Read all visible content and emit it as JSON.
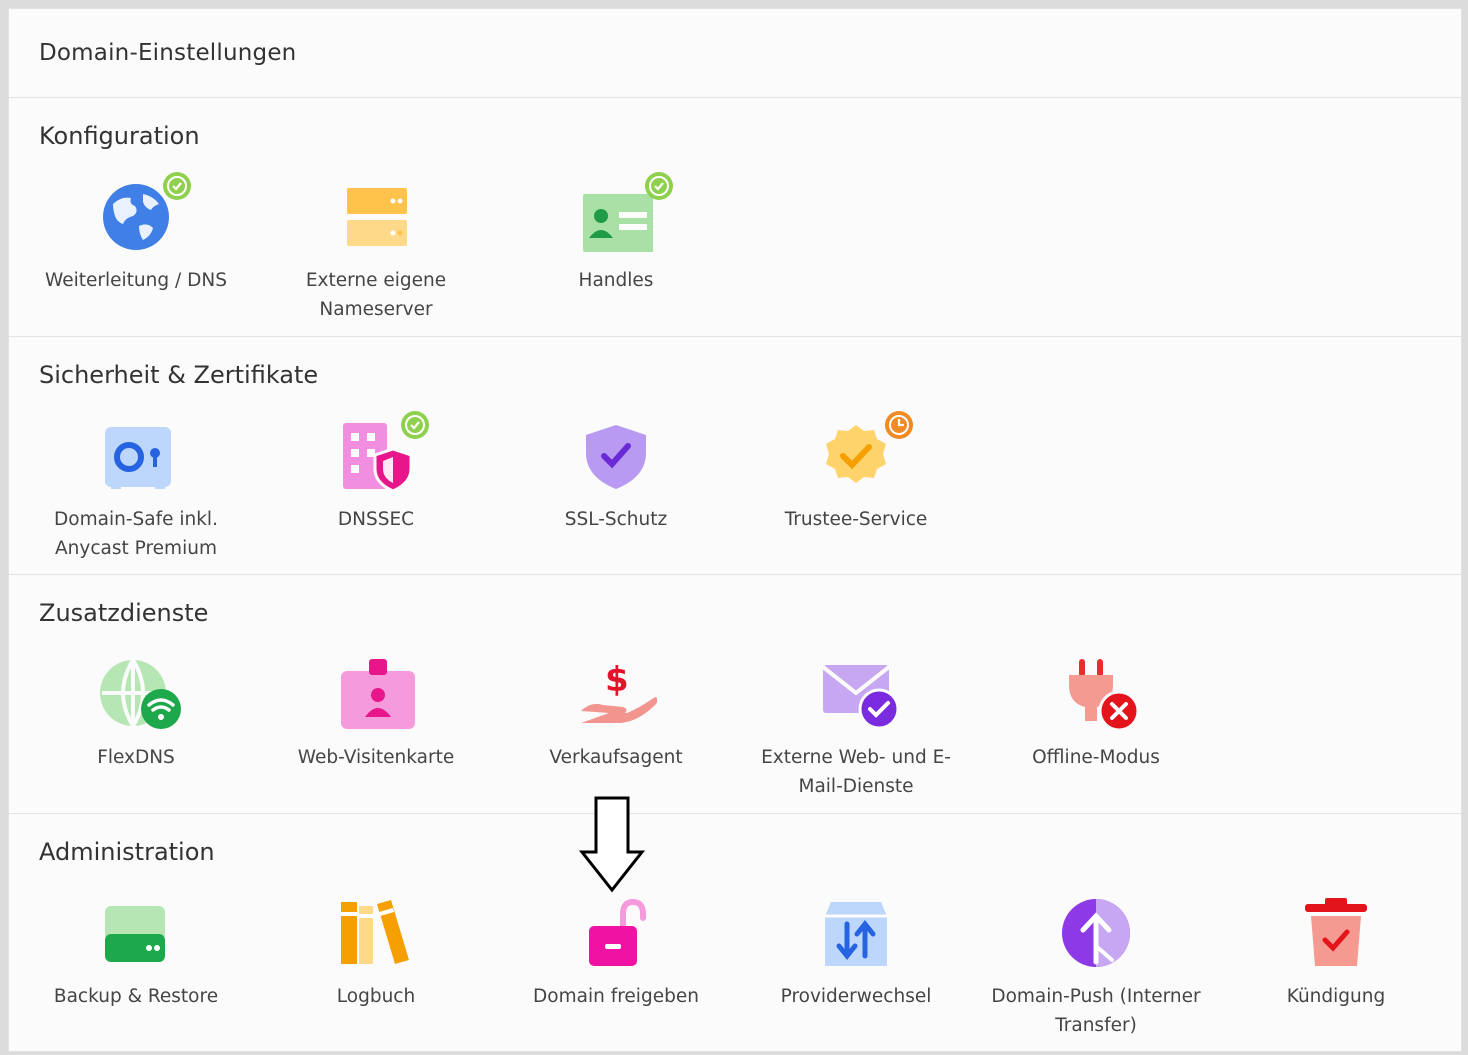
{
  "panel": {
    "title": "Domain-Einstellungen"
  },
  "sections": [
    {
      "title": "Konfiguration",
      "items": [
        {
          "label": "Weiterleitung / DNS",
          "icon": "globe-icon",
          "status": "check"
        },
        {
          "label": "Externe eigene Nameserver",
          "icon": "server-icon",
          "status": ""
        },
        {
          "label": "Handles",
          "icon": "contact-card-icon",
          "status": "check"
        }
      ]
    },
    {
      "title": "Sicherheit & Zertifikate",
      "items": [
        {
          "label": "Domain-Safe inkl. Anycast Premium",
          "icon": "safe-icon",
          "status": ""
        },
        {
          "label": "DNSSEC",
          "icon": "building-shield-icon",
          "status": "check"
        },
        {
          "label": "SSL-Schutz",
          "icon": "shield-check-icon",
          "status": ""
        },
        {
          "label": "Trustee-Service",
          "icon": "seal-check-icon",
          "status": "pending"
        }
      ]
    },
    {
      "title": "Zusatzdienste",
      "items": [
        {
          "label": "FlexDNS",
          "icon": "globe-wifi-icon",
          "status": ""
        },
        {
          "label": "Web-Visitenkarte",
          "icon": "badge-card-icon",
          "status": ""
        },
        {
          "label": "Verkaufsagent",
          "icon": "hand-dollar-icon",
          "status": ""
        },
        {
          "label": "Externe Web- und E-Mail-Dienste",
          "icon": "envelope-check-icon",
          "status": ""
        },
        {
          "label": "Offline-Modus",
          "icon": "plug-off-icon",
          "status": ""
        }
      ]
    },
    {
      "title": "Administration",
      "items": [
        {
          "label": "Backup & Restore",
          "icon": "drive-icon",
          "status": ""
        },
        {
          "label": "Logbuch",
          "icon": "books-icon",
          "status": ""
        },
        {
          "label": "Domain freigeben",
          "icon": "unlock-icon",
          "status": ""
        },
        {
          "label": "Providerwechsel",
          "icon": "box-transfer-icon",
          "status": ""
        },
        {
          "label": "Domain-Push (Interner Transfer)",
          "icon": "push-arrow-icon",
          "status": ""
        },
        {
          "label": "Kündigung",
          "icon": "trash-check-icon",
          "status": ""
        }
      ]
    }
  ],
  "colors": {
    "check_badge": "#8fd14f",
    "pending_badge": "#f08a24",
    "annotation_arrow": "#000000"
  }
}
